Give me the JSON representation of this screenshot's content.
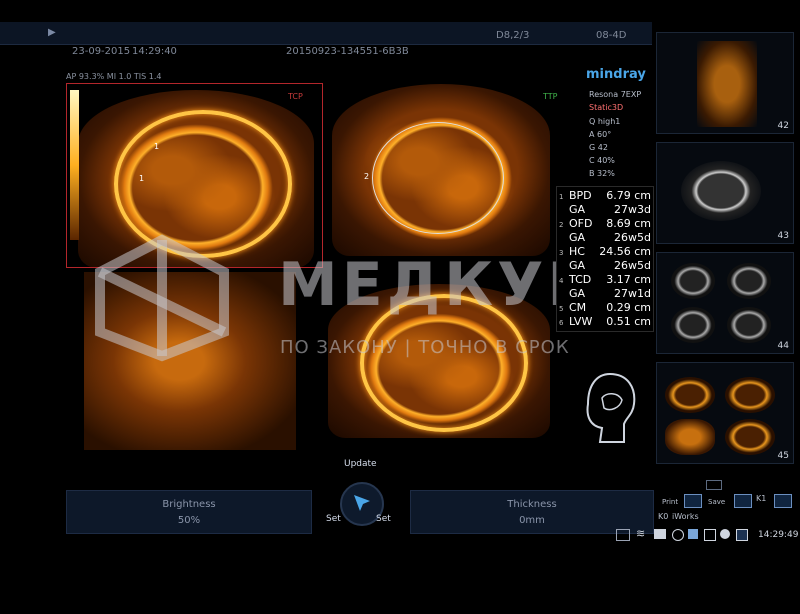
{
  "header": {
    "date": "23-09-2015",
    "time": "14:29:40",
    "exam_id": "20150923-134551-6B3B",
    "probe": "D8,2/3",
    "mode": "08-4D",
    "params": "AP 93.3%  MI 1.0  TIS 1.4"
  },
  "viewports": {
    "v1_label_tcp": "TCP",
    "v2_label_ttp": "TTP",
    "v2_marker": "2",
    "v1_marker_1": "1",
    "v1_marker_2": "1"
  },
  "device": {
    "brand": "mindray",
    "model": "Resona 7EXP",
    "preset": "Static3D",
    "q": "Q high1",
    "angle": "A 60°",
    "g": "G 42",
    "c": "C 40%",
    "b": "B 32%"
  },
  "measurements": [
    {
      "n": "1",
      "label": "BPD",
      "value": "6.79 cm"
    },
    {
      "n": "",
      "label": "GA",
      "value": "27w3d"
    },
    {
      "n": "2",
      "label": "OFD",
      "value": "8.69 cm"
    },
    {
      "n": "",
      "label": "GA",
      "value": "26w5d"
    },
    {
      "n": "3",
      "label": "HC",
      "value": "24.56 cm"
    },
    {
      "n": "",
      "label": "GA",
      "value": "26w5d"
    },
    {
      "n": "4",
      "label": "TCD",
      "value": "3.17 cm"
    },
    {
      "n": "",
      "label": "GA",
      "value": "27w1d"
    },
    {
      "n": "5",
      "label": "CM",
      "value": "0.29 cm"
    },
    {
      "n": "6",
      "label": "LVW",
      "value": "0.51 cm"
    }
  ],
  "thumbnails": [
    "42",
    "43",
    "44",
    "45"
  ],
  "controls": {
    "brightness_label": "Brightness",
    "brightness_value": "50%",
    "thickness_label": "Thickness",
    "thickness_value": "0mm",
    "update": "Update",
    "set_left": "Set",
    "set_right": "Set"
  },
  "tools": {
    "print": "Print",
    "save": "Save",
    "k1": "K1",
    "iworks": "iWorks",
    "k0": "K0",
    "clock": "14:29:49"
  },
  "watermark": {
    "title": "МЕДКУБ",
    "subtitle": "ПО ЗАКОНУ | ТОЧНО В СРОК"
  },
  "colors": {
    "accent": "#4aa6e8",
    "roi": "#b3262b",
    "ultrasound": "#ffb02a"
  }
}
